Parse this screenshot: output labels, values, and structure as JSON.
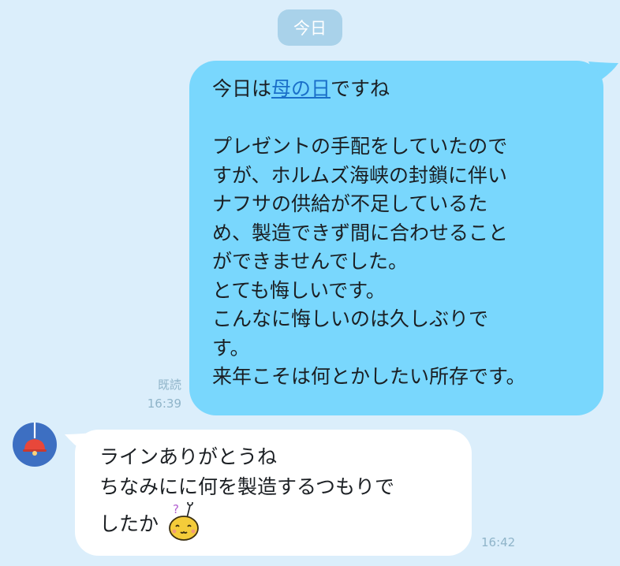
{
  "chat": {
    "date_label": "今日",
    "outgoing": {
      "lines": [
        {
          "before": "今日は",
          "link": "母の日",
          "after": "ですね"
        },
        {
          "text": ""
        },
        {
          "text": "プレゼントの手配をしていたので"
        },
        {
          "text": "すが、ホルムズ海峡の封鎖に伴い"
        },
        {
          "text": "ナフサの供給が不足しているた"
        },
        {
          "text": "め、製造できず間に合わせること"
        },
        {
          "text": "ができませんでした。"
        },
        {
          "text": "とても悔しいです。"
        },
        {
          "text": "こんなに悔しいのは久しぶりで"
        },
        {
          "text": "す。"
        },
        {
          "text": "来年こそは何とかしたい所存です。"
        }
      ],
      "read_label": "既読",
      "time": "16:39",
      "bubble_color": "#79d7fd"
    },
    "incoming": {
      "avatar_icon": "pendant-lamp-icon",
      "lines": [
        "ラインありがとうね",
        "ちなみにに何を製造するつもりで",
        "したか"
      ],
      "sticker_icon": "confused-face-emoji-icon",
      "time": "16:42",
      "bubble_color": "#ffffff"
    },
    "background_color": "#dbeefb",
    "link_color": "#1a6fc9"
  }
}
